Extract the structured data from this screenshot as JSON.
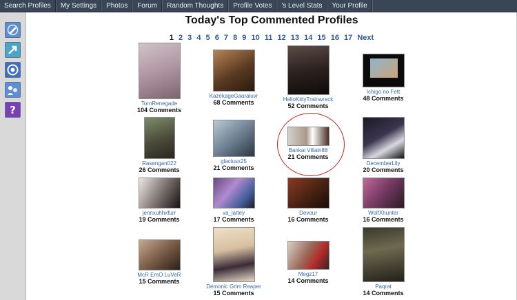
{
  "nav": {
    "items": [
      "Search Profiles",
      "My Settings",
      "Photos",
      "Forum",
      "Random Thoughts",
      "Profile Votes",
      "'s Level Stats",
      "Your Profile"
    ]
  },
  "rail": {
    "icons": [
      "edit-profile-icon",
      "share-arrow-icon",
      "target-icon",
      "people-icon",
      "help-question-icon"
    ]
  },
  "page": {
    "title": "Today's Top Commented Profiles"
  },
  "pager": {
    "current": "1",
    "pages": [
      "2",
      "3",
      "4",
      "5",
      "6",
      "7",
      "8",
      "9",
      "10",
      "11",
      "12",
      "13",
      "14",
      "15",
      "16",
      "17"
    ],
    "next_label": "Next"
  },
  "profiles": [
    {
      "name": "TornRenegade",
      "comments": "104 Comments"
    },
    {
      "name": "KazekageGaaraluvr",
      "comments": "68 Comments"
    },
    {
      "name": "HelloKittyTrainwreck",
      "comments": "52 Comments"
    },
    {
      "name": "Ichigo no Fett",
      "comments": "48 Comments"
    },
    {
      "name": "Rasengan022",
      "comments": "26 Comments"
    },
    {
      "name": "glaciusx25",
      "comments": "21 Comments"
    },
    {
      "name": "Bankai Villain88",
      "comments": "21 Comments"
    },
    {
      "name": "DecemberLily",
      "comments": "20 Comments"
    },
    {
      "name": "jennxuhhxfurr",
      "comments": "19 Comments"
    },
    {
      "name": "va_lattey",
      "comments": "17 Comments"
    },
    {
      "name": "Devour",
      "comments": "16 Comments"
    },
    {
      "name": "WolfXhunter",
      "comments": "16 Comments"
    },
    {
      "name": "McR EmO LuVeR",
      "comments": "15 Comments"
    },
    {
      "name": "Demonic Grim Reaper",
      "comments": "15 Comments"
    },
    {
      "name": "Megz17",
      "comments": "14 Comments"
    },
    {
      "name": "Paqrat",
      "comments": "14 Comments"
    }
  ],
  "colors": {
    "nav_bg": "#3a4556",
    "link": "#3a6aa8",
    "highlight": "#d52020"
  }
}
